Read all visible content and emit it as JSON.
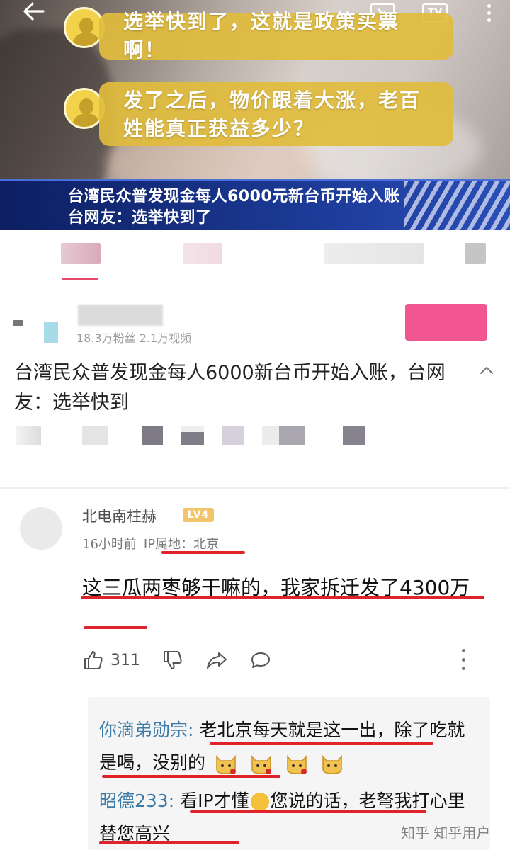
{
  "video": {
    "bubble1": "选举快到了，这就是政策买票啊！",
    "bubble2": "发了之后，物价跟着大涨，老百姓能真正获益多少？",
    "news_line1": "台湾民众普发现金每人6000元新台币开始入账",
    "news_line2": "台网友：选举快到了",
    "tv_label": "TV"
  },
  "uploader": {
    "stats": "18.3万粉丝   2.1万视频"
  },
  "title": "台湾民众普发现金每人6000新台币开始入账，台网友：选举快到",
  "comment": {
    "user": "北电南柱赫",
    "level": "LV4",
    "time": "16小时前",
    "ip": "IP属地：北京",
    "text": "这三瓜两枣够干嘛的，我家拆迁发了4300万",
    "likes": "311"
  },
  "replies": [
    {
      "name": "你滴弟勋宗",
      "sep": ": ",
      "text_a": "老北京每天就是这一出，除了吃就是喝，没别的",
      "text_b": ""
    },
    {
      "name": "昭德233",
      "sep": ": ",
      "text_a": "看IP才懂",
      "text_b": "您说的话，老弩我打心里替您高兴"
    }
  ],
  "watermark": "知乎 知乎用户",
  "colors": {
    "accent_pink": "#e8466b",
    "follow_pink": "#f25690",
    "bubble_yellow": "#e1bc3c",
    "news_blue": "#1c3a96",
    "reply_name_blue": "#3c7aa8",
    "annotation_red": "#e0232b"
  },
  "icons": [
    "back-arrow-icon",
    "pip-icon",
    "tv-icon",
    "more-vertical-icon",
    "thumbs-up-icon",
    "thumbs-down-icon",
    "share-icon",
    "comment-icon",
    "chevron-up-icon"
  ]
}
